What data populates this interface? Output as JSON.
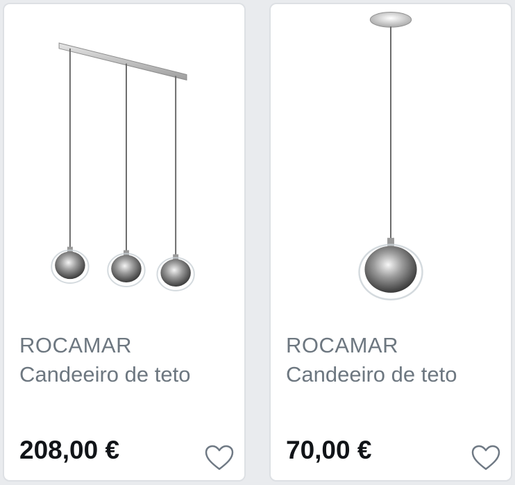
{
  "products": [
    {
      "brand": "ROCAMAR",
      "title": "Candeeiro de teto",
      "price": "208,00 €",
      "image_icon": "pendant-lamp-triple-icon",
      "favorite_icon": "heart-outline-icon"
    },
    {
      "brand": "ROCAMAR",
      "title": "Candeeiro de teto",
      "price": "70,00 €",
      "image_icon": "pendant-lamp-single-icon",
      "favorite_icon": "heart-outline-icon"
    }
  ],
  "colors": {
    "card_background": "#ffffff",
    "page_background": "#e9ebee",
    "text_muted": "#6d7780",
    "price_text": "#111418",
    "heart_stroke": "#6f7984"
  }
}
